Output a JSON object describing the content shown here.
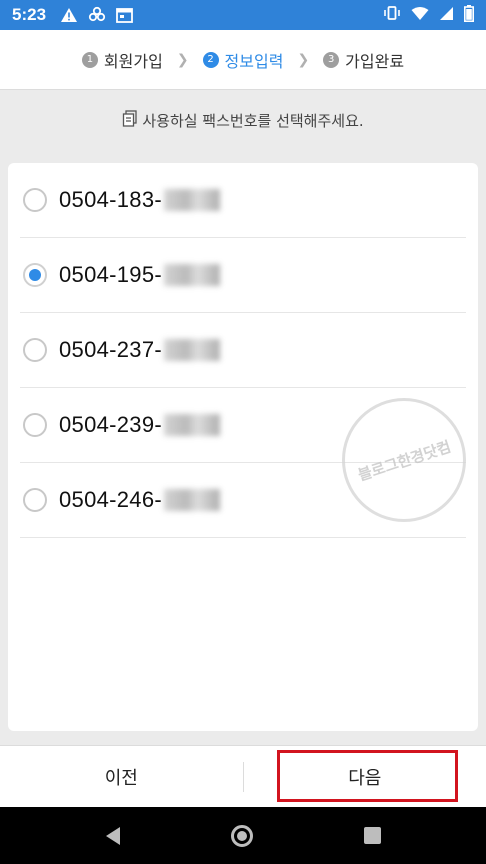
{
  "status_bar": {
    "time": "5:23",
    "icons_left": [
      "warning-icon",
      "pinwheel-icon",
      "calendar-icon"
    ],
    "icons_right": [
      "vibrate-icon",
      "wifi-icon",
      "signal-icon",
      "battery-icon"
    ],
    "background": "#2f82d8"
  },
  "steps": [
    {
      "num": "1",
      "label": "회원가입",
      "active": false
    },
    {
      "num": "2",
      "label": "정보입력",
      "active": true
    },
    {
      "num": "3",
      "label": "가입완료",
      "active": false
    }
  ],
  "instruction": "사용하실 팩스번호를 선택해주세요.",
  "fax_numbers": [
    {
      "prefix": "0504-183-",
      "selected": false
    },
    {
      "prefix": "0504-195-",
      "selected": true
    },
    {
      "prefix": "0504-237-",
      "selected": false
    },
    {
      "prefix": "0504-239-",
      "selected": false
    },
    {
      "prefix": "0504-246-",
      "selected": false
    }
  ],
  "watermark": "블로그한경닷컴",
  "buttons": {
    "prev": "이전",
    "next": "다음"
  },
  "colors": {
    "accent": "#2f8be6",
    "highlight": "#d2141f"
  }
}
